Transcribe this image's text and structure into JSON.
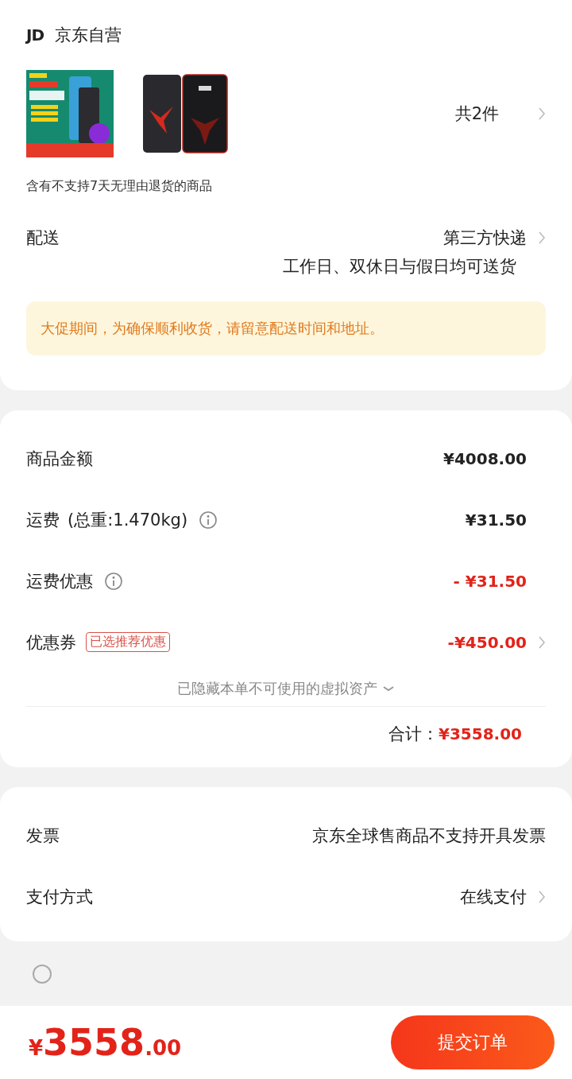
{
  "store": {
    "logo": "JD",
    "name": "京东自营"
  },
  "products": {
    "count": "共2件",
    "note": "含有不支持7天无理由退货的商品"
  },
  "delivery": {
    "label": "配送",
    "method": "第三方快递",
    "schedule": "工作日、双休日与假日均可送货"
  },
  "notice": "大促期间，为确保顺利收货，请留意配送时间和地址。",
  "costs": [
    {
      "label": "商品金额",
      "value": "¥4008.00",
      "discount": false,
      "info": false,
      "arrow": false
    },
    {
      "label": "运费",
      "detail": "(总重:1.470kg)",
      "value": "¥31.50",
      "discount": false,
      "info": true,
      "arrow": false
    },
    {
      "label": "运费优惠",
      "value": "- ¥31.50",
      "discount": true,
      "info": true,
      "arrow": false
    },
    {
      "label": "优惠券",
      "badge": "已选推荐优惠",
      "value": "-¥450.00",
      "discount": true,
      "info": false,
      "arrow": true
    }
  ],
  "hidden_assets": "已隐藏本单不可使用的虚拟资产",
  "total": {
    "label": "合计：",
    "value": "¥3558.00"
  },
  "other": [
    {
      "label": "发票",
      "value": "京东全球售商品不支持开具发票",
      "arrow": false
    },
    {
      "label": "支付方式",
      "value": "在线支付",
      "arrow": true
    }
  ],
  "agreement": {
    "checked": false
  },
  "footer": {
    "currency": "¥",
    "amount": "3558",
    "decimals": ".00",
    "submit": "提交订单"
  }
}
